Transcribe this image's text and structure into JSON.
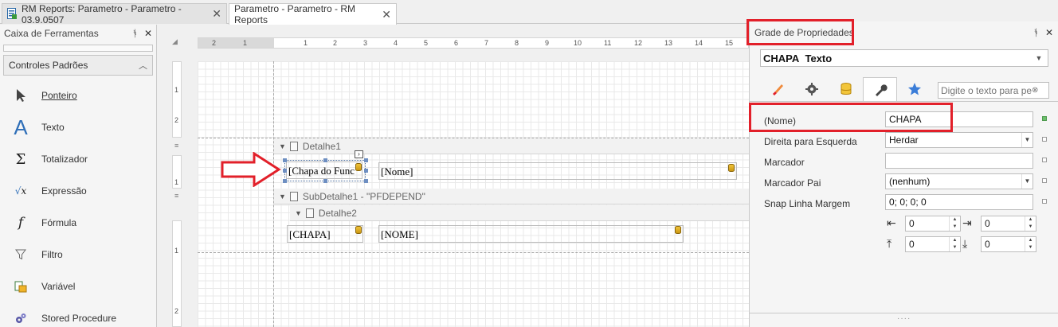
{
  "tabs": [
    {
      "label": "RM Reports: Parametro - Parametro - 03.9.0507",
      "active": false
    },
    {
      "label": "Parametro - Parametro - RM Reports",
      "active": true
    }
  ],
  "toolbox": {
    "title": "Caixa de Ferramentas",
    "group": "Controles Padrões",
    "items": [
      {
        "label": "Ponteiro",
        "icon": "pointer-icon"
      },
      {
        "label": "Texto",
        "icon": "text-icon"
      },
      {
        "label": "Totalizador",
        "icon": "sigma-icon"
      },
      {
        "label": "Expressão",
        "icon": "sqrt-icon"
      },
      {
        "label": "Fórmula",
        "icon": "function-icon"
      },
      {
        "label": "Filtro",
        "icon": "funnel-icon"
      },
      {
        "label": "Variável",
        "icon": "variable-icon"
      },
      {
        "label": "Stored Procedure",
        "icon": "gears-icon"
      }
    ]
  },
  "designer": {
    "hruler_numbers": [
      "2",
      "1",
      "1",
      "2",
      "3",
      "4",
      "5",
      "6",
      "7",
      "8",
      "9",
      "10",
      "11",
      "12",
      "13",
      "14",
      "15"
    ],
    "vruler_top": [
      "1",
      "2"
    ],
    "vruler_mid": [
      "1"
    ],
    "vruler_bot": [
      "1",
      "2"
    ],
    "bands": {
      "detalhe1": "Detalhe1",
      "subdetalhe1": "SubDetalhe1 - \"PFDEPEND\"",
      "detalhe2": "Detalhe2"
    },
    "fields": {
      "chapa_func": "[Chapa do Func",
      "nome": "[Nome]",
      "chapa": "[CHAPA]",
      "nome_upper": "[NOME]"
    }
  },
  "properties": {
    "title": "Grade de Propriedades",
    "object": {
      "name": "CHAPA",
      "type": "Texto"
    },
    "search_placeholder": "Digite o texto para pesquisar",
    "rows": [
      {
        "name": "(Nome)",
        "value": "CHAPA"
      },
      {
        "name": "Direita para Esquerda",
        "value": "Herdar"
      },
      {
        "name": "Marcador",
        "value": ""
      },
      {
        "name": "Marcador Pai",
        "value": "(nenhum)"
      },
      {
        "name": "Snap Linha Margem",
        "value": "0; 0; 0; 0"
      }
    ],
    "margins": {
      "left": "0",
      "right": "0",
      "top": "0",
      "bottom": "0"
    }
  },
  "colors": {
    "highlight": "#e2202a",
    "selection": "#4c6f9f"
  }
}
